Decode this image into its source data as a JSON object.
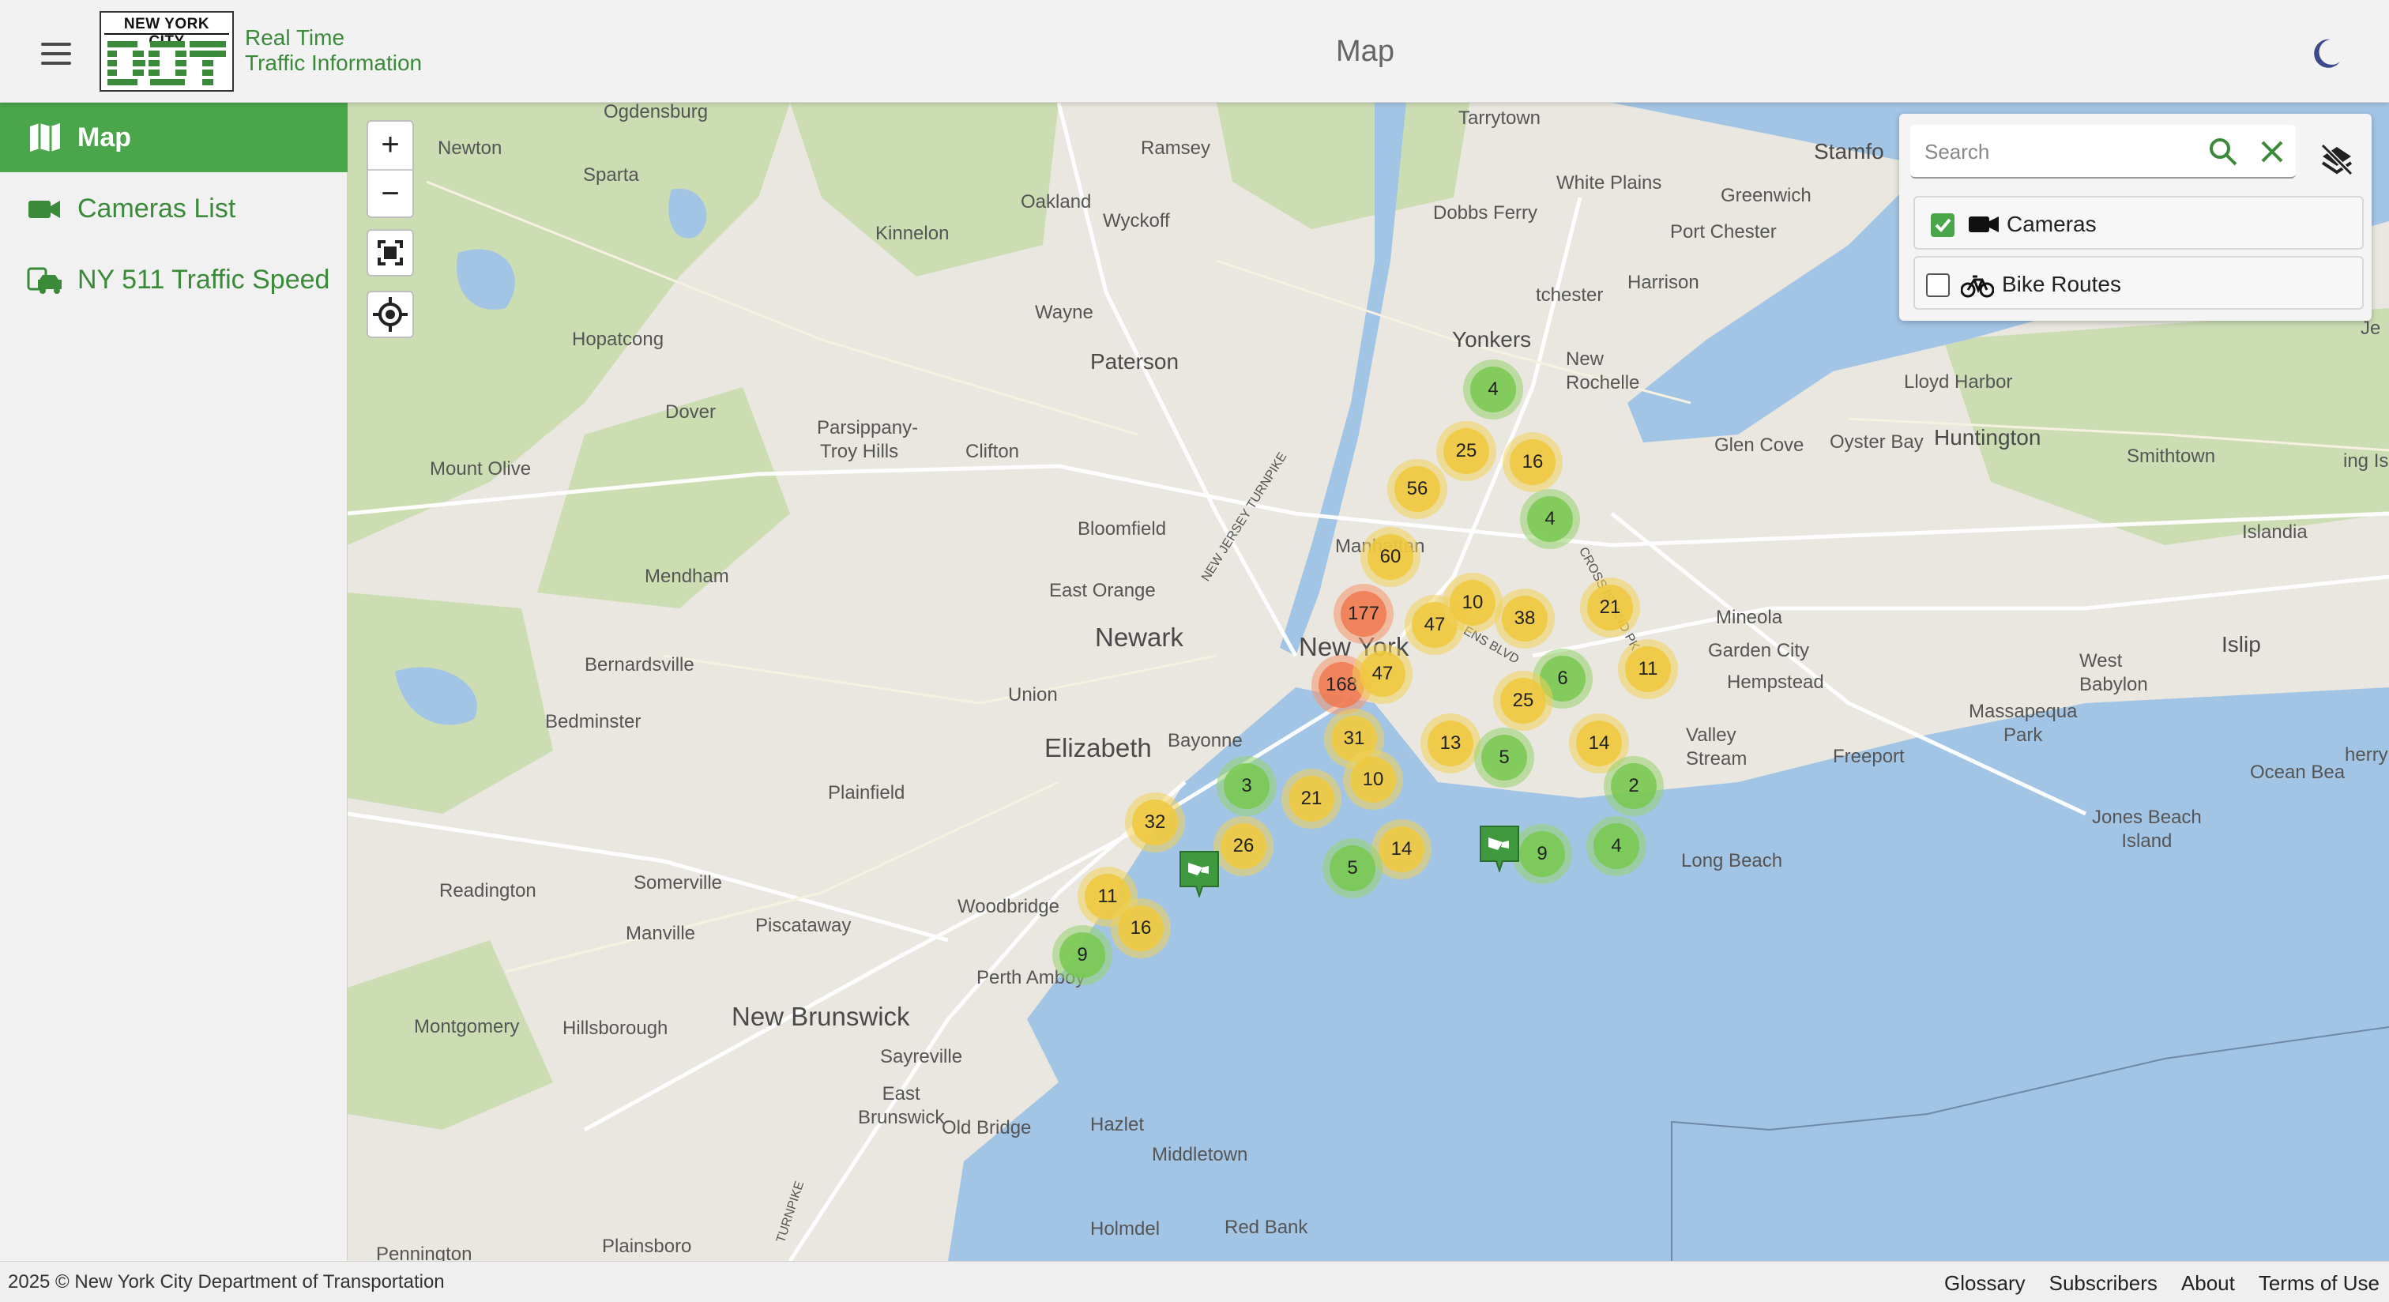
{
  "header": {
    "menu_icon": "hamburger-icon",
    "logo_top_text": "NEW YORK CITY",
    "logo_main_text": "DOT",
    "logo_line1": "Real Time",
    "logo_line2": "Traffic Information",
    "title": "Map",
    "theme_icon": "moon-icon"
  },
  "sidebar": {
    "items": [
      {
        "label": "Map",
        "icon": "map-icon",
        "active": true
      },
      {
        "label": "Cameras List",
        "icon": "video-camera-icon",
        "active": false
      },
      {
        "label": "NY 511 Traffic Speed",
        "icon": "traffic-car-icon",
        "active": false
      }
    ]
  },
  "map_controls": {
    "zoom_in": "+",
    "zoom_out": "−",
    "fullscreen_icon": "fullscreen-icon",
    "locate_icon": "locate-icon"
  },
  "layer_panel": {
    "search_placeholder": "Search",
    "search_icon": "search-icon",
    "clear_icon": "close-icon",
    "hide_layers_icon": "layers-off-icon",
    "layers": [
      {
        "label": "Cameras",
        "icon": "video-camera-icon",
        "checked": true
      },
      {
        "label": "Bike Routes",
        "icon": "bicycle-icon",
        "checked": false
      }
    ]
  },
  "places": {
    "ogdensburg": "Ogdensburg",
    "newton": "Newton",
    "sparta": "Sparta",
    "ramsey": "Ramsey",
    "oakland": "Oakland",
    "wyckoff": "Wyckoff",
    "kinnelon": "Kinnelon",
    "tarrytown": "Tarrytown",
    "dobbs_ferry": "Dobbs Ferry",
    "white_plains": "White Plains",
    "greenwich": "Greenwich",
    "stamford": "Stamfo",
    "port_chester": "Port Chester",
    "harrison": "Harrison",
    "manchester": "tchester",
    "wayne": "Wayne",
    "paterson": "Paterson",
    "yonkers": "Yonkers",
    "new_rochelle": "New\nRochelle",
    "lloyd_harbor": "Lloyd Harbor",
    "glen_cove": "Glen Cove",
    "oyster_bay": "Oyster Bay",
    "huntington": "Huntington",
    "smithtown": "Smithtown",
    "kings_park": "ing Is",
    "hopatcong": "Hopatcong",
    "dover": "Dover",
    "parsippany": "Parsippany-",
    "troy_hills": "Troy Hills",
    "clifton": "Clifton",
    "mount_olive": "Mount Olive",
    "bloomfield": "Bloomfield",
    "islandia": "Islandia",
    "mendham": "Mendham",
    "east_orange": "East Orange",
    "mineola": "Mineola",
    "newark": "Newark",
    "new_york": "New York",
    "garden_city": "Garden City",
    "hempstead": "Hempstead",
    "islip": "Islip",
    "west_babylon": "West\nBabylon",
    "bernardsville": "Bernardsville",
    "union": "Union",
    "bedminster": "Bedminster",
    "elizabeth": "Elizabeth",
    "bayonne": "Bayonne",
    "valley_stream": "Valley\nStream",
    "freeport": "Freeport",
    "massapequa_park": "Massapequa\nPark",
    "plainfield": "Plainfield",
    "ocean_beach": "Ocean Bea",
    "jones_beach": "Jones Beach\nIsland",
    "readington": "Readington",
    "somerville": "Somerville",
    "long_beach": "Long Beach",
    "manville": "Manville",
    "piscataway": "Piscataway",
    "woodbridge": "Woodbridge",
    "perth_amboy": "Perth Amboy",
    "new_brunswick": "New Brunswick",
    "montgomery": "Montgomery",
    "hillsborough": "Hillsborough",
    "sayreville": "Sayreville",
    "east_brunswick": "East\nBrunswick",
    "old_bridge": "Old Bridge",
    "hazlet": "Hazlet",
    "middletown": "Middletown",
    "holmdel": "Holmdel",
    "red_bank": "Red Bank",
    "pennington": "Pennington",
    "plainsboro": "Plainsboro",
    "manhattan": "Manhattan",
    "nj_turnpike": "NEW JERSEY TURNPIKE",
    "jericho": "Je",
    "cherry": "herry",
    "tpke": "TURNPIKE",
    "queens_blvd": "ENS BLVD",
    "cross_island": "CROSS ISLAND PK"
  },
  "clusters": [
    {
      "count": "4",
      "level": "g"
    },
    {
      "count": "25",
      "level": "y"
    },
    {
      "count": "16",
      "level": "y"
    },
    {
      "count": "56",
      "level": "y"
    },
    {
      "count": "4",
      "level": "g"
    },
    {
      "count": "60",
      "level": "y"
    },
    {
      "count": "177",
      "level": "o"
    },
    {
      "count": "47",
      "level": "y"
    },
    {
      "count": "10",
      "level": "y"
    },
    {
      "count": "38",
      "level": "y"
    },
    {
      "count": "21",
      "level": "y"
    },
    {
      "count": "168",
      "level": "o"
    },
    {
      "count": "47",
      "level": "y"
    },
    {
      "count": "6",
      "level": "g"
    },
    {
      "count": "11",
      "level": "y"
    },
    {
      "count": "25",
      "level": "y"
    },
    {
      "count": "31",
      "level": "y"
    },
    {
      "count": "13",
      "level": "y"
    },
    {
      "count": "5",
      "level": "g"
    },
    {
      "count": "14",
      "level": "y"
    },
    {
      "count": "3",
      "level": "g"
    },
    {
      "count": "10",
      "level": "y"
    },
    {
      "count": "21",
      "level": "y"
    },
    {
      "count": "2",
      "level": "g"
    },
    {
      "count": "32",
      "level": "y"
    },
    {
      "count": "26",
      "level": "y"
    },
    {
      "count": "14",
      "level": "y"
    },
    {
      "count": "4",
      "level": "g"
    },
    {
      "count": "5",
      "level": "g"
    },
    {
      "count": "9",
      "level": "g"
    },
    {
      "count": "11",
      "level": "y"
    },
    {
      "count": "16",
      "level": "y"
    },
    {
      "count": "9",
      "level": "g"
    }
  ],
  "footer": {
    "copyright": "2025 © New York City Department of Transportation",
    "links": [
      "Glossary",
      "Subscribers",
      "About",
      "Terms of Use"
    ]
  },
  "colors": {
    "brand_green": "#4aa64a",
    "text_green": "#3a8a3a",
    "water": "#a3c5e5",
    "land": "#e9e7df",
    "forest": "#c9dcae"
  }
}
